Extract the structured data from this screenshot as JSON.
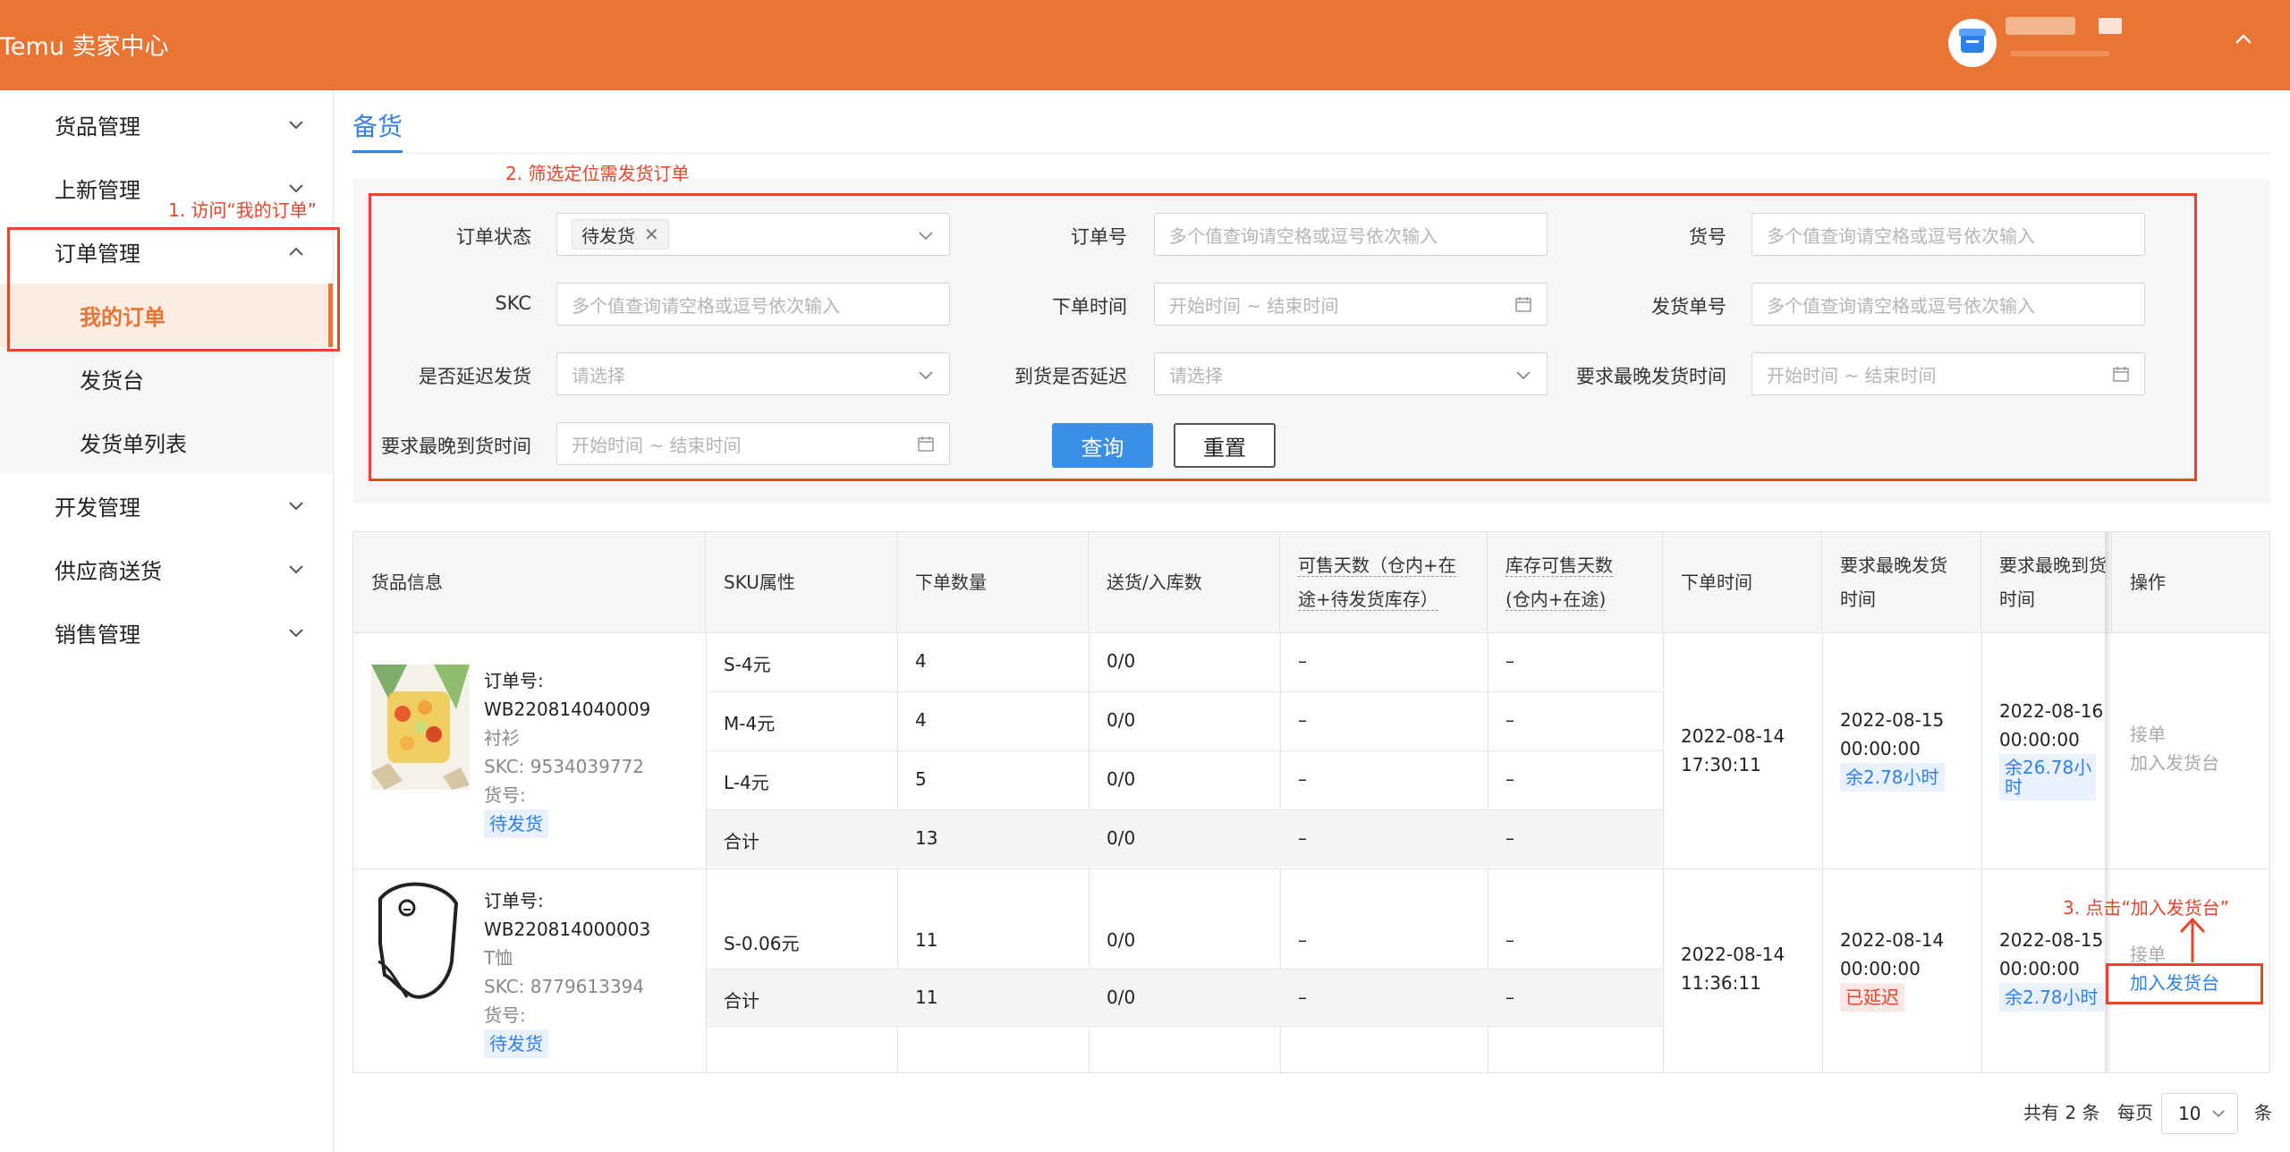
{
  "header": {
    "brand": "Temu 卖家中心"
  },
  "sidebar": {
    "groups": [
      {
        "label": "货品管理"
      },
      {
        "label": "上新管理"
      },
      {
        "label": "订单管理"
      },
      {
        "label": "开发管理"
      },
      {
        "label": "供应商送货"
      },
      {
        "label": "销售管理"
      }
    ],
    "order_sub": [
      {
        "label": "我的订单",
        "active": true
      },
      {
        "label": "发货台"
      },
      {
        "label": "发货单列表"
      }
    ]
  },
  "annotations": {
    "step1": "1. 访问“我的订单”",
    "step2": "2. 筛选定位需发货订单",
    "step3": "3. 点击“加入发货台”"
  },
  "main": {
    "tab": "备货"
  },
  "filters": {
    "order_status_label": "订单状态",
    "order_status_tag": "待发货",
    "order_no_label": "订单号",
    "order_no_placeholder": "多个值查询请空格或逗号依次输入",
    "goods_no_label": "货号",
    "goods_no_placeholder": "多个值查询请空格或逗号依次输入",
    "skc_label": "SKC",
    "skc_placeholder": "多个值查询请空格或逗号依次输入",
    "order_time_label": "下单时间",
    "order_time_placeholder": "开始时间 ~ 结束时间",
    "ship_no_label": "发货单号",
    "ship_no_placeholder": "多个值查询请空格或逗号依次输入",
    "delay_ship_label": "是否延迟发货",
    "delay_ship_placeholder": "请选择",
    "delay_arrive_label": "到货是否延迟",
    "delay_arrive_placeholder": "请选择",
    "latest_ship_label": "要求最晚发货时间",
    "latest_ship_placeholder": "开始时间 ~ 结束时间",
    "latest_arrive_label": "要求最晚到货时间",
    "latest_arrive_placeholder": "开始时间 ~ 结束时间",
    "query_button": "查询",
    "reset_button": "重置"
  },
  "table": {
    "headers": {
      "goods": "货品信息",
      "sku": "SKU属性",
      "qty": "下单数量",
      "delivered": "送货/入库数",
      "sale_days_1": "可售天数（仓内+在",
      "sale_days_2": "途+待发货库存）",
      "stock_days_1": "库存可售天数",
      "stock_days_2": "(仓内+在途)",
      "order_time": "下单时间",
      "latest_ship_1": "要求最晚发货",
      "latest_ship_2": "时间",
      "latest_arrive_1": "要求最晚到货",
      "latest_arrive_2": "时间",
      "actions": "操作"
    },
    "orders": [
      {
        "order_label": "订单号:",
        "order_no": "WB220814040009",
        "category": "衬衫",
        "skc": "SKC: 9534039772",
        "goods_no": "货号:",
        "status": "待发货",
        "rows": [
          {
            "sku": "S-4元",
            "qty": "4",
            "delivered": "0/0",
            "sale_days": "–",
            "stock_days": "–"
          },
          {
            "sku": "M-4元",
            "qty": "4",
            "delivered": "0/0",
            "sale_days": "–",
            "stock_days": "–"
          },
          {
            "sku": "L-4元",
            "qty": "5",
            "delivered": "0/0",
            "sale_days": "–",
            "stock_days": "–"
          },
          {
            "sku": "合计",
            "qty": "13",
            "delivered": "0/0",
            "sale_days": "–",
            "stock_days": "–"
          }
        ],
        "order_date": "2022-08-14",
        "order_clock": "17:30:11",
        "ship_date": "2022-08-15",
        "ship_clock": "00:00:00",
        "ship_remain": "余2.78小时",
        "arrive_date": "2022-08-16",
        "arrive_clock": "00:00:00",
        "arrive_remain_1": "余26.78小",
        "arrive_remain_2": "时",
        "action_accept": "接单",
        "action_add": "加入发货台"
      },
      {
        "order_label": "订单号:",
        "order_no": "WB220814000003",
        "category": "T恤",
        "skc": "SKC: 8779613394",
        "goods_no": "货号:",
        "status": "待发货",
        "rows": [
          {
            "sku": "S-0.06元",
            "qty": "11",
            "delivered": "0/0",
            "sale_days": "–",
            "stock_days": "–"
          },
          {
            "sku": "合计",
            "qty": "11",
            "delivered": "0/0",
            "sale_days": "–",
            "stock_days": "–"
          }
        ],
        "order_date": "2022-08-14",
        "order_clock": "11:36:11",
        "ship_date": "2022-08-14",
        "ship_clock": "00:00:00",
        "ship_remain": "已延迟",
        "arrive_date": "2022-08-15",
        "arrive_clock": "00:00:00",
        "arrive_remain": "余2.78小时",
        "action_accept": "接单",
        "action_add": "加入发货台"
      }
    ]
  },
  "pagination": {
    "total": "共有 2 条",
    "per_page_label": "每页",
    "per_page_value": "10",
    "unit": "条"
  },
  "colors": {
    "brand": "#ea7433",
    "primary": "#3a8ee6",
    "annotation": "#e8452c"
  }
}
